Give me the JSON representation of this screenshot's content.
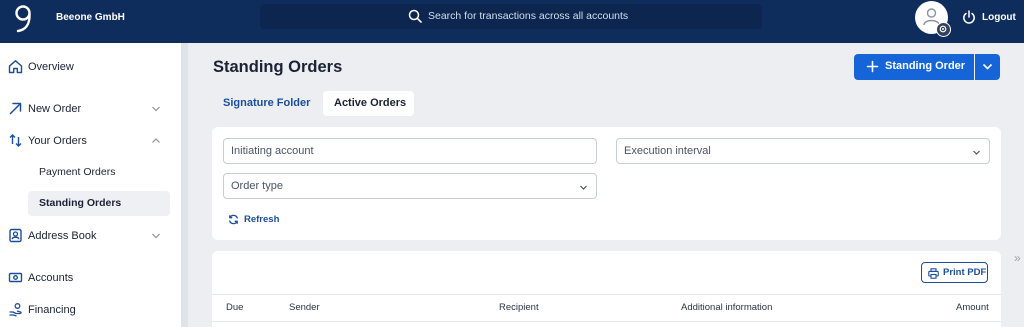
{
  "header": {
    "company_name": "Beeone GmbH",
    "search_placeholder": "Search for transactions across all accounts",
    "logout_label": "Logout"
  },
  "sidebar": {
    "items": [
      {
        "label": "Overview",
        "icon": "home-icon"
      },
      {
        "label": "New Order",
        "icon": "arrow-up-right-icon"
      },
      {
        "label": "Your Orders",
        "icon": "sort-arrows-icon"
      },
      {
        "label": "Payment Orders"
      },
      {
        "label": "Standing Orders"
      },
      {
        "label": "Address Book",
        "icon": "contact-book-icon"
      },
      {
        "label": "Accounts",
        "icon": "banknote-icon"
      },
      {
        "label": "Financing",
        "icon": "hand-coins-icon"
      }
    ],
    "active_item": "Standing Orders"
  },
  "main": {
    "title": "Standing Orders",
    "primary_button": "Standing Order",
    "tabs": [
      {
        "label": "Signature Folder"
      },
      {
        "label": "Active Orders"
      }
    ],
    "active_tab": "Active Orders",
    "filters": {
      "initiating_account": "Initiating account",
      "execution_interval": "Execution interval",
      "order_type": "Order type",
      "refresh_label": "Refresh"
    },
    "table": {
      "print_label": "Print PDF",
      "columns": [
        "Due",
        "Sender",
        "Recipient",
        "Additional information",
        "Amount"
      ]
    }
  },
  "colors": {
    "header_bg": "#0f2d5c",
    "accent": "#1565d8",
    "link": "#1a4e9c"
  }
}
